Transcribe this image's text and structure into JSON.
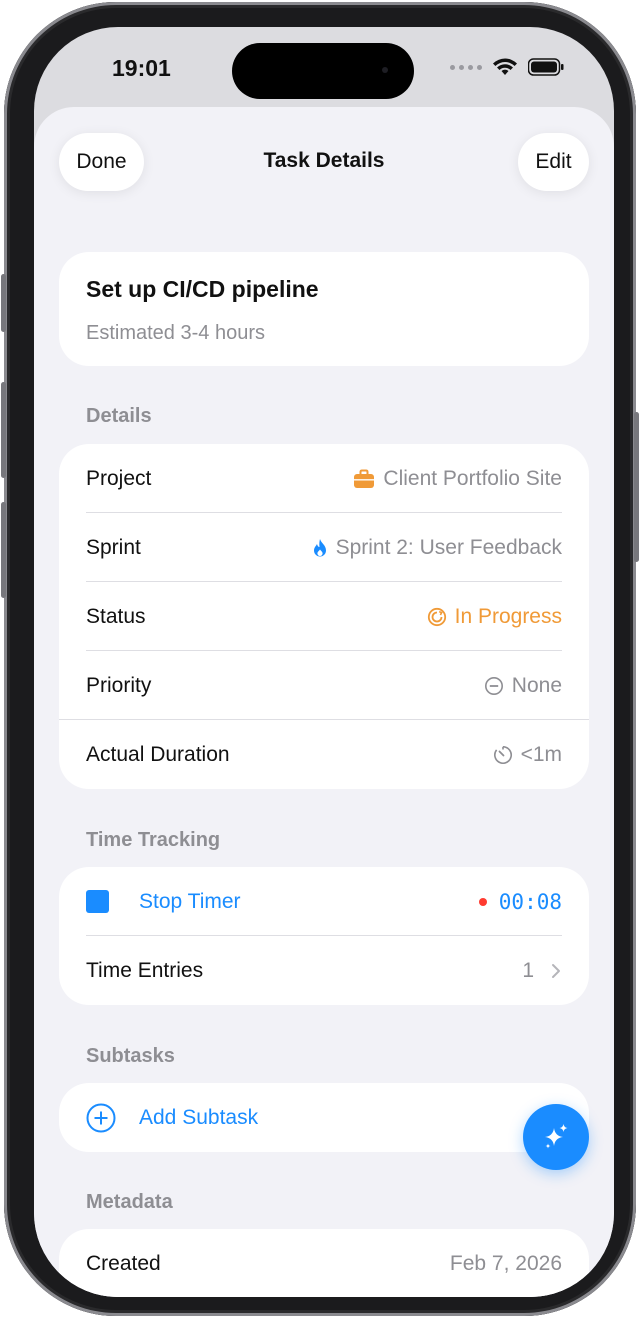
{
  "status_bar": {
    "time": "19:01"
  },
  "nav": {
    "done_label": "Done",
    "title": "Task Details",
    "edit_label": "Edit"
  },
  "task": {
    "title": "Set up CI/CD pipeline",
    "estimate": "Estimated 3-4 hours"
  },
  "details": {
    "section_label": "Details",
    "project": {
      "label": "Project",
      "value": "Client Portfolio Site",
      "icon": "briefcase-icon",
      "icon_color": "#f09a37"
    },
    "sprint": {
      "label": "Sprint",
      "value": "Sprint 2: User Feedback",
      "icon": "flame-icon",
      "icon_color": "#1a8cff"
    },
    "status": {
      "label": "Status",
      "value": "In Progress",
      "icon": "progress-icon",
      "color": "#f09a37"
    },
    "priority": {
      "label": "Priority",
      "value": "None",
      "icon": "minus-circle-icon"
    },
    "duration": {
      "label": "Actual Duration",
      "value": "<1m",
      "icon": "timer-icon"
    }
  },
  "time_tracking": {
    "section_label": "Time Tracking",
    "stop_timer_label": "Stop Timer",
    "timer_value": "00:08",
    "recording_color": "#ff3b30",
    "entries_label": "Time Entries",
    "entries_count": "1"
  },
  "subtasks": {
    "section_label": "Subtasks",
    "add_label": "Add Subtask"
  },
  "metadata": {
    "section_label": "Metadata",
    "created_label": "Created",
    "created_value": "Feb 7, 2026"
  },
  "colors": {
    "accent": "#1a8cff",
    "background": "#f2f2f7"
  }
}
